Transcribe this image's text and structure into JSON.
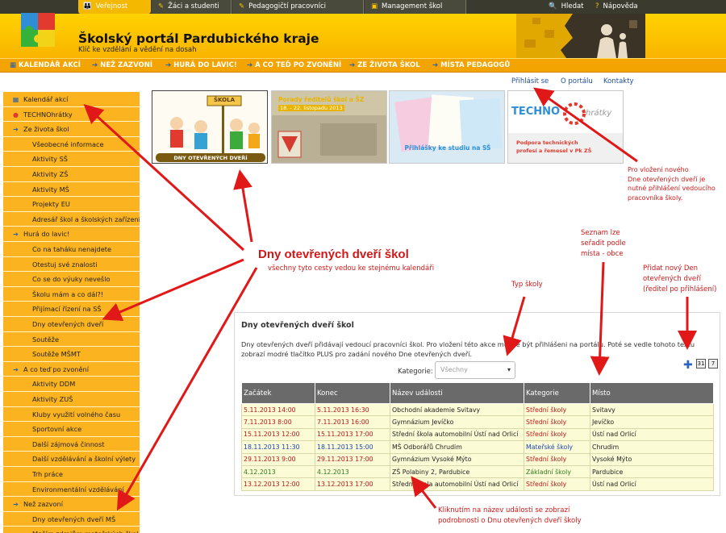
{
  "top_nav": {
    "items": [
      {
        "label": "Veřejnost",
        "icon": "people-icon"
      },
      {
        "label": "Žáci a studenti",
        "icon": "student-icon"
      },
      {
        "label": "Pedagogičtí pracovníci",
        "icon": "teacher-icon"
      },
      {
        "label": "Management škol",
        "icon": "briefcase-icon"
      }
    ],
    "search": "Hledat",
    "help": "Nápověda"
  },
  "header": {
    "title": "Školský portál Pardubického kraje",
    "subtitle": "Klíč ke vzdělání a vědění na dosah"
  },
  "menu": [
    "KALENDÁŘ AKCÍ",
    "NEŽ ZAZVONÍ",
    "HURÁ DO LAVIC!",
    "A CO TEĎ PO ZVONĚNÍ",
    "ZE ŽIVOTA ŠKOL",
    "MÍSTA PEDAGOGŮ"
  ],
  "user_links": [
    "Přihlásit se",
    "O portálu",
    "Kontakty"
  ],
  "sidebar": [
    {
      "label": "Kalendář akcí",
      "type": "top",
      "icon": "calendar-icon"
    },
    {
      "label": "TECHNOhrátky",
      "type": "top",
      "icon": "techno-icon"
    },
    {
      "label": "Ze života škol",
      "type": "top",
      "icon": "arrow-icon"
    },
    {
      "label": "Všeobecné informace",
      "type": "sub"
    },
    {
      "label": "Aktivity SŠ",
      "type": "sub"
    },
    {
      "label": "Aktivity ZŠ",
      "type": "sub"
    },
    {
      "label": "Aktivity MŠ",
      "type": "sub"
    },
    {
      "label": "Projekty EU",
      "type": "sub"
    },
    {
      "label": "Adresář škol a školských zařízení",
      "type": "sub"
    },
    {
      "label": "Hurá do lavic!",
      "type": "top",
      "icon": "arrow-icon"
    },
    {
      "label": "Co na taháku nenajdete",
      "type": "sub"
    },
    {
      "label": "Otestuj své znalosti",
      "type": "sub"
    },
    {
      "label": "Co se do výuky nevešlo",
      "type": "sub"
    },
    {
      "label": "Školu mám a co dál?!",
      "type": "sub"
    },
    {
      "label": "Přijímací řízení na SŠ",
      "type": "sub"
    },
    {
      "label": "Dny otevřených dveří",
      "type": "sub"
    },
    {
      "label": "Soutěže",
      "type": "sub"
    },
    {
      "label": "Soutěže MŠMT",
      "type": "sub"
    },
    {
      "label": "A co teď po zvonění",
      "type": "top",
      "icon": "arrow-icon"
    },
    {
      "label": "Aktivity DDM",
      "type": "sub"
    },
    {
      "label": "Aktivity ZUŠ",
      "type": "sub"
    },
    {
      "label": "Kluby využití volného času",
      "type": "sub"
    },
    {
      "label": "Sportovní akce",
      "type": "sub"
    },
    {
      "label": "Další zájmová činnost",
      "type": "sub"
    },
    {
      "label": "Další vzdělávání a školní výlety",
      "type": "sub"
    },
    {
      "label": "Trh práce",
      "type": "sub"
    },
    {
      "label": "Environmentální vzdělávání",
      "type": "sub"
    },
    {
      "label": "Než zazvoní",
      "type": "top",
      "icon": "arrow-icon"
    },
    {
      "label": "Dny otevřených dveří MŠ",
      "type": "sub"
    },
    {
      "label": "Maším zdrojům mateřských škol",
      "type": "sub"
    }
  ],
  "tiles": {
    "t1_sign": "ŠKOLA",
    "t1_caption": "DNY OTEVŘENÝCH DVEŘÍ",
    "t2_line1": "Porady ředitelů škol a ŠZ",
    "t2_line2": "18. - 22. listopadu 2013",
    "t3_caption": "Přihlášky ke studiu na SŠ",
    "t4_brand": "TECHNO",
    "t4_brand2": "hrátky",
    "t4_caption1": "Podpora technických",
    "t4_caption2": "profesí a řemesel v Pk ZŠ"
  },
  "panel": {
    "title": "Dny otevřených dveří škol",
    "desc": "Dny otevřených dveří přidávají vedoucí pracovníci škol. Pro vložení této akce musíte být přihlášeni na portálu. Poté se vedle tohoto textu zobrazí modré tlačítko PLUS pro zadání nového Dne otevřených dveří.",
    "category_label": "Kategorie:",
    "category_value": "Všechny",
    "cal_31": "31",
    "cal_7": "7"
  },
  "table": {
    "headers": [
      "Začátek",
      "Konec",
      "Název události",
      "Kategorie",
      "Místo"
    ],
    "rows": [
      {
        "start": "5.11.2013 14:00",
        "end": "5.11.2013 16:30",
        "name": "Obchodní akademie Svitavy",
        "cat": "Střední školy",
        "place": "Svitavy",
        "color": "#c0141a"
      },
      {
        "start": "7.11.2013 8:00",
        "end": "7.11.2013 16:00",
        "name": "Gymnázium Jevíčko",
        "cat": "Střední školy",
        "place": "Jevíčko",
        "color": "#c0141a"
      },
      {
        "start": "15.11.2013 12:00",
        "end": "15.11.2013 17:00",
        "name": "Střední škola automobilní Ústí nad Orlicí",
        "cat": "Střední školy",
        "place": "Ústí nad Orlicí",
        "color": "#c0141a"
      },
      {
        "start": "18.11.2013 11:30",
        "end": "18.11.2013 15:00",
        "name": "MŠ Odborářů Chrudim",
        "cat": "Mateřské školy",
        "place": "Chrudim",
        "color": "#1a44b8"
      },
      {
        "start": "29.11.2013 9:00",
        "end": "29.11.2013 17:00",
        "name": "Gymnázium Vysoké Mýto",
        "cat": "Střední školy",
        "place": "Vysoké Mýto",
        "color": "#c0141a"
      },
      {
        "start": "4.12.2013",
        "end": "4.12.2013",
        "name": "ZŠ Polabiny 2, Pardubice",
        "cat": "Základní školy",
        "place": "Pardubice",
        "color": "#2e7a1e"
      },
      {
        "start": "13.12.2013 12:00",
        "end": "13.12.2013 17:00",
        "name": "Střední škola automobilní Ústí nad Orlicí",
        "cat": "Střední školy",
        "place": "Ústí nad Orlicí",
        "color": "#c0141a"
      }
    ]
  },
  "annotations": {
    "big_title": "Dny otevřených dveří škol",
    "big_sub": "všechny tyto cesty vedou ke stejnému kalendáři",
    "login_note": [
      "Pro vložení nového",
      "Dne otevřených dveří je",
      "nutné přihlášení vedoucího",
      "pracovníka školy."
    ],
    "sort_note": [
      "Seznam lze",
      "seřadit podle",
      "místa - obce"
    ],
    "add_note": [
      "Přidat nový Den",
      "otevřených dveří",
      "(ředitel po přihlášení)"
    ],
    "type_note": "Typ školy",
    "click_note": [
      "Kliknutím na název události se zobrazí",
      "podrobnosti o Dnu otevřených dveří školy"
    ]
  },
  "colors": {
    "accent": "#f5b800",
    "annotation": "#d01818"
  }
}
